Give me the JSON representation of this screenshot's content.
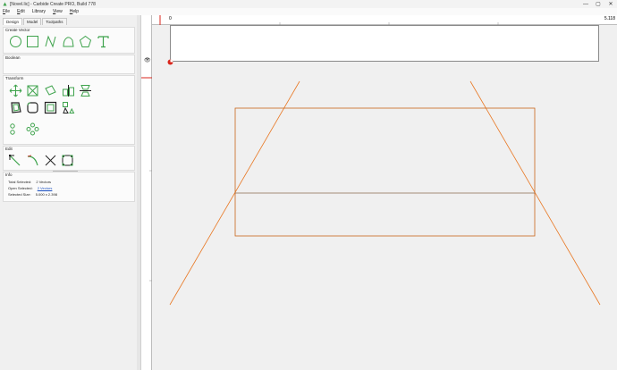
{
  "window": {
    "title": "[Novel.lic] - Carbide Create PRO, Build 778",
    "controls": {
      "minimize": "—",
      "maximize": "▢",
      "close": "✕"
    }
  },
  "menu": [
    {
      "label": "File",
      "underline": "F",
      "rest": "ile"
    },
    {
      "label": "Edit",
      "underline": "E",
      "rest": "dit"
    },
    {
      "label": "Library",
      "underline": "",
      "rest": "Library"
    },
    {
      "label": "View",
      "underline": "V",
      "rest": "iew"
    },
    {
      "label": "Help",
      "underline": "H",
      "rest": "elp"
    }
  ],
  "tabs": [
    "Design",
    "Model",
    "Toolpaths"
  ],
  "sections": {
    "create_vector": "Create Vector",
    "boolean": "Boolean",
    "transform": "Transform",
    "edit": "Edit",
    "info": "Info"
  },
  "tooltip": "Trim Vectors",
  "info": {
    "total_selected_label": "Total Selected:",
    "total_selected_value": "2 Vectors",
    "open_selected_label": "Open Selected:",
    "open_selected_value": "2 Vectors",
    "selected_size_label": "Selected Size:",
    "selected_size_value": "5.000 x 2.398"
  },
  "ruler": {
    "start": "0",
    "end": "5.118"
  },
  "colors": {
    "vector_orange": "#e87722",
    "icon_green": "#3fa34d",
    "origin_red": "#d9261c",
    "link_blue": "#1a4fc1"
  }
}
